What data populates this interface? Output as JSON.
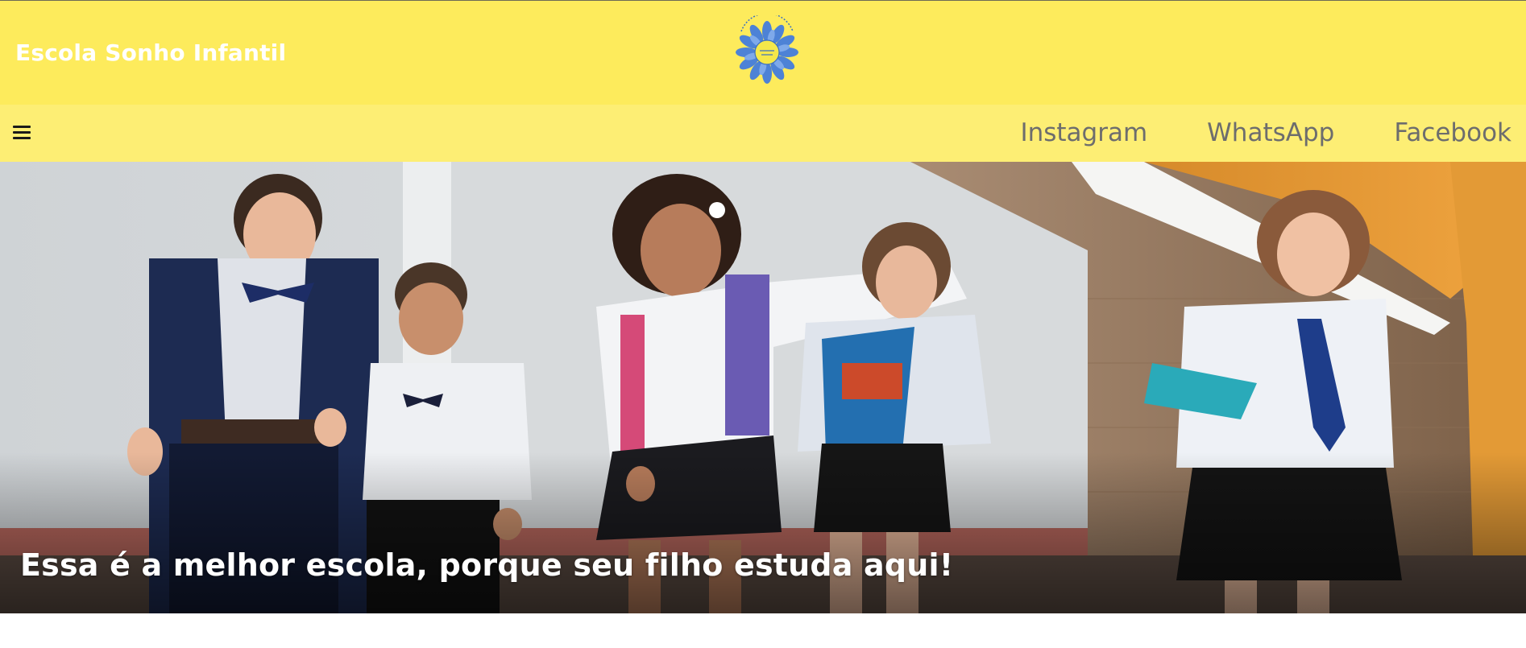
{
  "header": {
    "brand_name": "Escola Sonho Infantil",
    "logo_icon": "sunflower-logo-icon"
  },
  "navbar": {
    "menu_icon": "hamburger-menu-icon",
    "links": [
      {
        "label": "Instagram"
      },
      {
        "label": "WhatsApp"
      },
      {
        "label": "Facebook"
      }
    ]
  },
  "hero": {
    "image": "children-running-in-school-uniforms-photo",
    "caption": "Essa é a melhor escola, porque seu filho estuda aqui!"
  },
  "colors": {
    "header_bg": "#fdeb5c",
    "navbar_bg": "#fdee74",
    "nav_link": "#6d6d6d",
    "brand_text": "#ffffff"
  }
}
